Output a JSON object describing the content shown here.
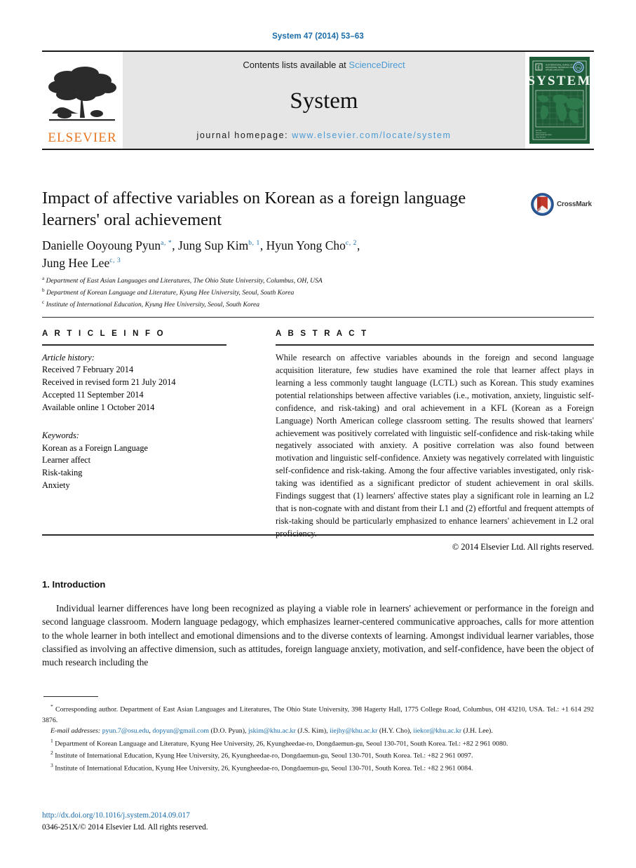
{
  "running_head": "System 47 (2014) 53–63",
  "masthead": {
    "contents_prefix": "Contents lists available at ",
    "sciencedirect": "ScienceDirect",
    "journal_name": "System",
    "homepage_label": "journal homepage:",
    "homepage_url": "www.elsevier.com/locate/system",
    "publisher": "ELSEVIER",
    "cover_title": "SYSTEM",
    "cover_subtitle": "AN INTERNATIONAL JOURNAL OF EDUCATIONAL TECHNOLOGY AND APPLIED LINGUISTICS",
    "colors": {
      "link": "#4a9ad4",
      "elsevier_orange": "#e87722",
      "cover_green": "#1f5c38",
      "masthead_grey": "#e6e6e6"
    }
  },
  "article": {
    "title": "Impact of affective variables on Korean as a foreign language learners' oral achievement",
    "crossmark_label": "CrossMark",
    "authors_line1": "Danielle Ooyoung Pyun",
    "authors_line1_sup": "a, *",
    "authors_line2": "Jung Sup Kim",
    "authors_line2_sup": "b, 1",
    "authors_line3": "Hyun Yong Cho",
    "authors_line3_sup": "c, 2",
    "authors_line4": "Jung Hee Lee",
    "authors_line4_sup": "c, 3",
    "affiliations": [
      {
        "marker": "a",
        "text": "Department of East Asian Languages and Literatures, The Ohio State University, Columbus, OH, USA"
      },
      {
        "marker": "b",
        "text": "Department of Korean Language and Literature, Kyung Hee University, Seoul, South Korea"
      },
      {
        "marker": "c",
        "text": "Institute of International Education, Kyung Hee University, Seoul, South Korea"
      }
    ]
  },
  "article_info": {
    "heading": "A R T I C L E  I N F O",
    "history_label": "Article history:",
    "history": [
      "Received 7 February 2014",
      "Received in revised form 21 July 2014",
      "Accepted 11 September 2014",
      "Available online 1 October 2014"
    ],
    "keywords_label": "Keywords:",
    "keywords": [
      "Korean as a Foreign Language",
      "Learner affect",
      "Risk-taking",
      "Anxiety"
    ]
  },
  "abstract": {
    "heading": "A B S T R A C T",
    "text": "While research on affective variables abounds in the foreign and second language acquisition literature, few studies have examined the role that learner affect plays in learning a less commonly taught language (LCTL) such as Korean. This study examines potential relationships between affective variables (i.e., motivation, anxiety, linguistic self-confidence, and risk-taking) and oral achievement in a KFL (Korean as a Foreign Language) North American college classroom setting. The results showed that learners' achievement was positively correlated with linguistic self-confidence and risk-taking while negatively associated with anxiety. A positive correlation was also found between motivation and linguistic self-confidence. Anxiety was negatively correlated with linguistic self-confidence and risk-taking. Among the four affective variables investigated, only risk-taking was identified as a significant predictor of student achievement in oral skills. Findings suggest that (1) learners' affective states play a significant role in learning an L2 that is non-cognate with and distant from their L1 and (2) effortful and frequent attempts of risk-taking should be particularly emphasized to enhance learners' achievement in L2 oral proficiency.",
    "copyright": "© 2014 Elsevier Ltd. All rights reserved."
  },
  "introduction": {
    "heading": "1. Introduction",
    "paragraph": "Individual learner differences have long been recognized as playing a viable role in learners' achievement or performance in the foreign and second language classroom. Modern language pedagogy, which emphasizes learner-centered communicative approaches, calls for more attention to the whole learner in both intellect and emotional dimensions and to the diverse contexts of learning. Amongst individual learner variables, those classified as involving an affective dimension, such as attitudes, foreign language anxiety, motivation, and self-confidence, have been the object of much research including the"
  },
  "footnotes": {
    "corresponding": "Corresponding author. Department of East Asian Languages and Literatures, The Ohio State University, 398 Hagerty Hall, 1775 College Road, Columbus, OH 43210, USA. Tel.: +1 614 292 3876.",
    "email_label": "E-mail addresses:",
    "emails": [
      {
        "address": "pyun.7@osu.edu",
        "sep": ", "
      },
      {
        "address": "dopyun@gmail.com",
        "sep": " (D.O. Pyun), "
      },
      {
        "address": "jskim@khu.ac.kr",
        "sep": " (J.S. Kim), "
      },
      {
        "address": "iiejhy@khu.ac.kr",
        "sep": " (H.Y. Cho), "
      },
      {
        "address": "iiekor@khu.ac.kr",
        "sep": " (J.H. Lee)."
      }
    ],
    "note1": "Department of Korean Language and Literature, Kyung Hee University, 26, Kyungheedae-ro, Dongdaemun-gu, Seoul 130-701, South Korea. Tel.: +82 2 961 0080.",
    "note2": "Institute of International Education, Kyung Hee University, 26, Kyungheedae-ro, Dongdaemun-gu, Seoul 130-701, South Korea. Tel.: +82 2 961 0097.",
    "note3": "Institute of International Education, Kyung Hee University, 26, Kyungheedae-ro, Dongdaemun-gu, Seoul 130-701, South Korea. Tel.: +82 2 961 0084."
  },
  "footer": {
    "doi": "http://dx.doi.org/10.1016/j.system.2014.09.017",
    "issn_line": "0346-251X/© 2014 Elsevier Ltd. All rights reserved."
  }
}
